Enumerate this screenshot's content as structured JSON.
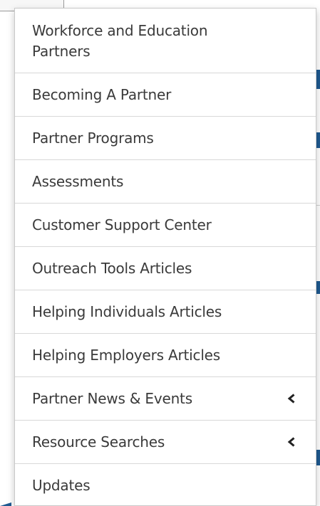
{
  "menu": {
    "items": [
      {
        "label": "Workforce and Education\nPartners",
        "has_submenu": false
      },
      {
        "label": "Becoming A Partner",
        "has_submenu": false
      },
      {
        "label": "Partner Programs",
        "has_submenu": false
      },
      {
        "label": "Assessments",
        "has_submenu": false
      },
      {
        "label": "Customer Support Center",
        "has_submenu": false
      },
      {
        "label": "Outreach Tools Articles",
        "has_submenu": false
      },
      {
        "label": "Helping Individuals Articles",
        "has_submenu": false
      },
      {
        "label": "Helping Employers Articles",
        "has_submenu": false
      },
      {
        "label": "Partner News & Events",
        "has_submenu": true,
        "icon": "chevron-left-icon"
      },
      {
        "label": "Resource Searches",
        "has_submenu": true,
        "icon": "chevron-left-icon"
      },
      {
        "label": "Updates",
        "has_submenu": false
      }
    ]
  },
  "colors": {
    "text": "#3a3a3a",
    "divider": "#d8d8d8",
    "accent": "#1f5a91",
    "panel_border": "#c9c9c9"
  }
}
